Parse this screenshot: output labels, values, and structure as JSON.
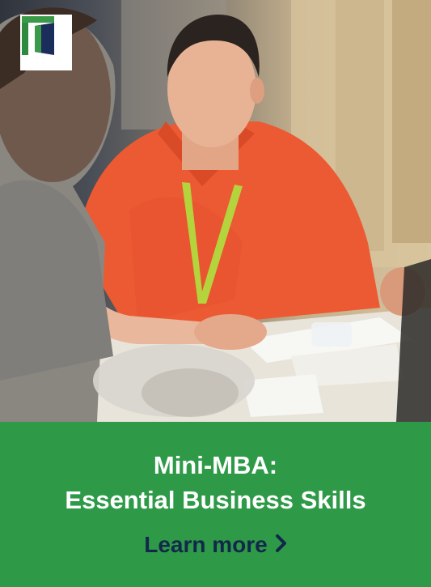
{
  "ad": {
    "headline_line1": "Mini-MBA:",
    "headline_line2": "Essential Business Skills",
    "cta_label": "Learn more",
    "cta_icon": "chevron-right-icon"
  },
  "colors": {
    "panel_green": "#2e9a48",
    "cta_navy": "#12284a",
    "logo_green": "#3a9a4a",
    "logo_navy": "#1b2d5a",
    "shirt_orange": "#ec5a34",
    "lanyard_lime": "#b5d33d"
  },
  "photo": {
    "description_icon": "photo-image"
  }
}
